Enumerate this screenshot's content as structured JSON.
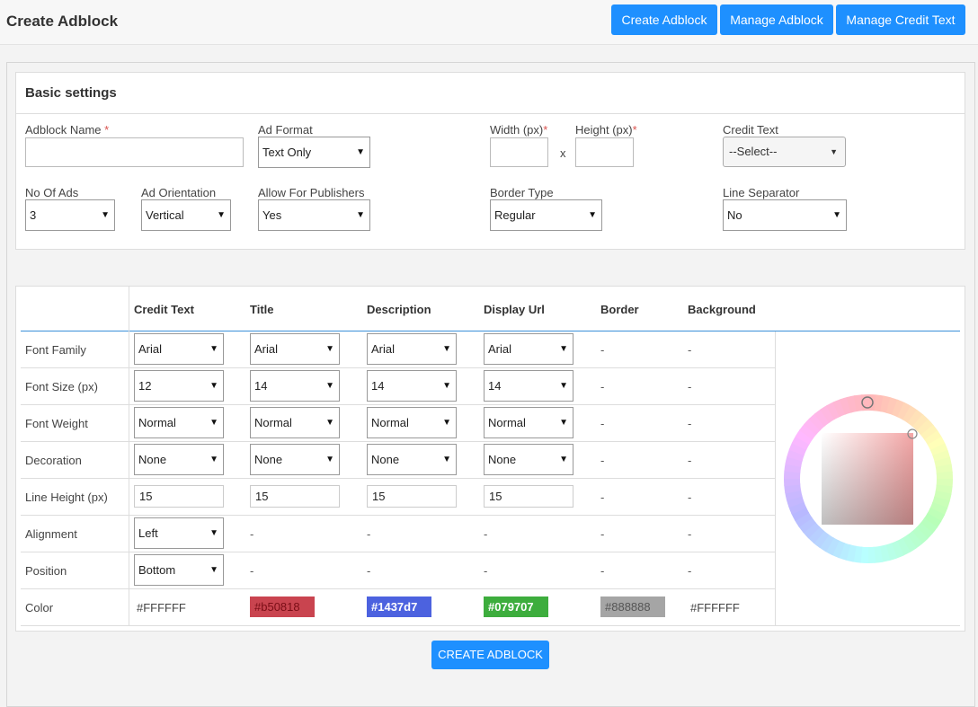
{
  "header": {
    "title": "Create Adblock",
    "buttons": [
      "Create Adblock",
      "Manage Adblock",
      "Manage Credit Text"
    ]
  },
  "basic": {
    "title": "Basic settings",
    "adblock_name": {
      "label": "Adblock Name",
      "required": "*",
      "value": ""
    },
    "ad_format": {
      "label": "Ad Format",
      "value": "Text Only"
    },
    "width": {
      "label": "Width (px)",
      "required": "*",
      "value": ""
    },
    "x": "x",
    "height": {
      "label": "Height (px)",
      "required": "*",
      "value": ""
    },
    "credit_text": {
      "label": "Credit Text",
      "value": "--Select--"
    },
    "no_of_ads": {
      "label": "No Of Ads",
      "value": "3"
    },
    "ad_orientation": {
      "label": "Ad Orientation",
      "value": "Vertical"
    },
    "allow_publishers": {
      "label": "Allow For Publishers",
      "value": "Yes"
    },
    "border_type": {
      "label": "Border Type",
      "value": "Regular"
    },
    "line_separator": {
      "label": "Line Separator",
      "value": "No"
    }
  },
  "style_table": {
    "columns": [
      "Credit Text",
      "Title",
      "Description",
      "Display Url",
      "Border",
      "Background"
    ],
    "rows": [
      {
        "label": "Font Family",
        "cells": [
          "Arial",
          "Arial",
          "Arial",
          "Arial"
        ]
      },
      {
        "label": "Font Size (px)",
        "cells": [
          "12",
          "14",
          "14",
          "14"
        ]
      },
      {
        "label": "Font Weight",
        "cells": [
          "Normal",
          "Normal",
          "Normal",
          "Normal"
        ]
      },
      {
        "label": "Decoration",
        "cells": [
          "None",
          "None",
          "None",
          "None"
        ]
      },
      {
        "label": "Line Height (px)",
        "cells": [
          "15",
          "15",
          "15",
          "15"
        ]
      },
      {
        "label": "Alignment",
        "cells": [
          "Left"
        ]
      },
      {
        "label": "Position",
        "cells": [
          "Bottom"
        ]
      },
      {
        "label": "Color",
        "cells": [
          "#FFFFFF",
          "#b50818",
          "#1437d7",
          "#079707",
          "#888888",
          "#FFFFFF"
        ]
      }
    ],
    "dash": "-",
    "color_swatches": {
      "title": "#c9444f",
      "description": "#4c62df",
      "display_url": "#3dad3d",
      "border": "#a5a5a5"
    }
  },
  "footer": {
    "create_button": "CREATE ADBLOCK"
  },
  "colors": {
    "accent": "#1e90ff",
    "divider_blue": "#1e90ff"
  }
}
